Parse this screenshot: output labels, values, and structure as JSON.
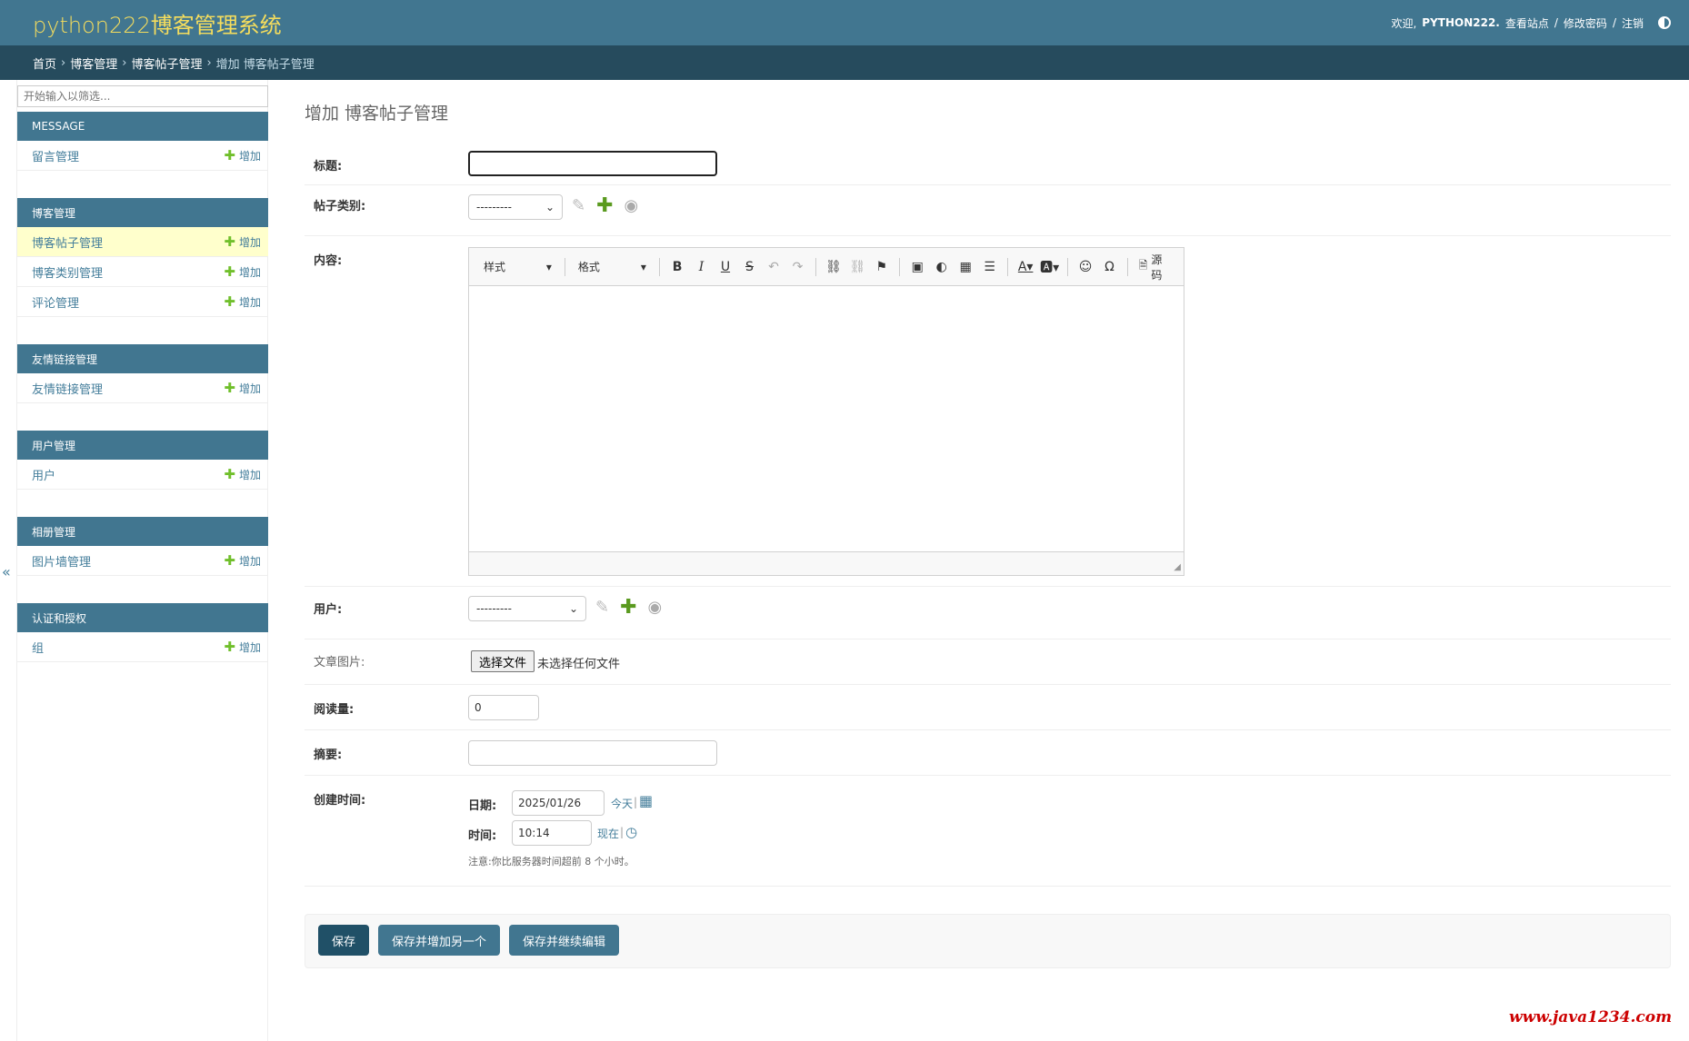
{
  "header": {
    "site_name": "python222博客管理系统",
    "welcome": "欢迎,",
    "username": "PYTHON222.",
    "view_site": "查看站点",
    "sep": "/",
    "change_password": "修改密码",
    "logout": "注销"
  },
  "breadcrumbs": {
    "home": "首页",
    "app": "博客管理",
    "model": "博客帖子管理",
    "current": "增加 博客帖子管理",
    "sep": "›"
  },
  "sidebar": {
    "filter_placeholder": "开始输入以筛选...",
    "add_label": "增加",
    "collapse": "«",
    "modules": [
      {
        "caption": "MESSAGE",
        "items": [
          "留言管理"
        ]
      },
      {
        "caption": "博客管理",
        "items": [
          "博客帖子管理",
          "博客类别管理",
          "评论管理"
        ]
      },
      {
        "caption": "友情链接管理",
        "items": [
          "友情链接管理"
        ]
      },
      {
        "caption": "用户管理",
        "items": [
          "用户"
        ]
      },
      {
        "caption": "相册管理",
        "items": [
          "图片墙管理"
        ]
      },
      {
        "caption": "认证和授权",
        "items": [
          "组"
        ]
      }
    ]
  },
  "form": {
    "title": "增加 博客帖子管理",
    "fields": {
      "title_label": "标题:",
      "title_value": "",
      "category_label": "帖子类别:",
      "category_value": "---------",
      "content_label": "内容:",
      "user_label": "用户:",
      "user_value": "---------",
      "image_label": "文章图片:",
      "image_button": "选择文件",
      "image_status": "未选择任何文件",
      "views_label": "阅读量:",
      "views_value": "0",
      "summary_label": "摘要:",
      "summary_value": "",
      "created_label": "创建时间:",
      "date_label": "日期:",
      "date_value": "2025/01/26",
      "today_link": "今天",
      "time_label": "时间:",
      "time_value": "10:14",
      "now_link": "现在",
      "pipe": "|",
      "note": "注意:你比服务器时间超前 8 个小时。"
    },
    "editor": {
      "styles_combo": "样式",
      "format_combo": "格式",
      "source_label": "源码"
    }
  },
  "submit": {
    "save": "保存",
    "save_add_another": "保存并增加另一个",
    "save_continue": "保存并继续编辑"
  },
  "watermark": "www.java1234.com",
  "colors": {
    "header_bg": "#417690",
    "breadcrumb_bg": "#264b5d",
    "accent_yellow": "#f5dd5d",
    "link": "#447e9b",
    "add_green": "#70bf2b"
  }
}
